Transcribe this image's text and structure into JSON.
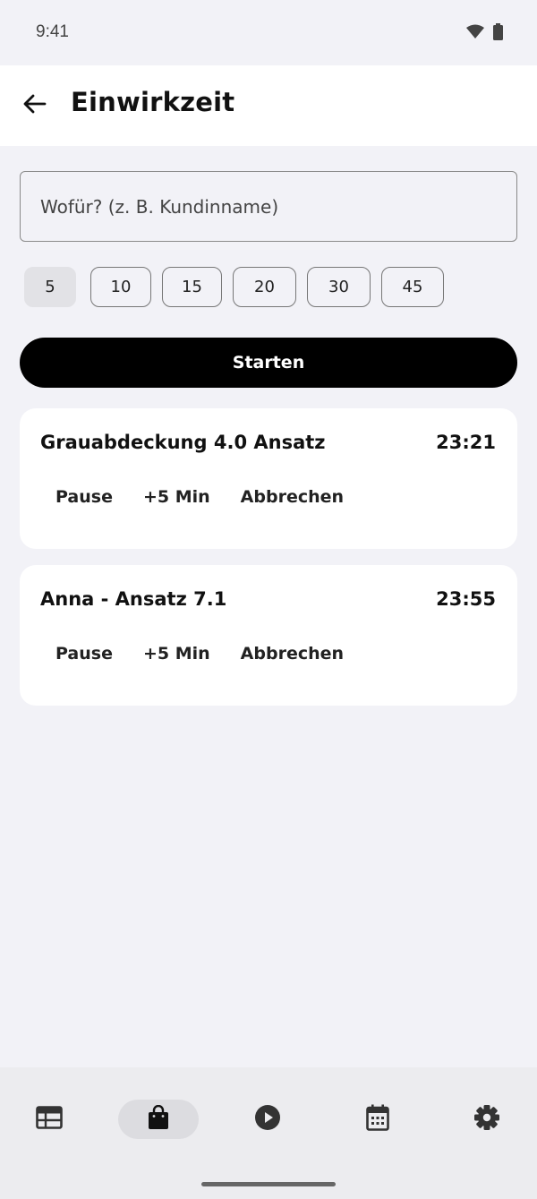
{
  "status_bar": {
    "time": "9:41",
    "icons": [
      "wifi-icon",
      "battery-icon"
    ]
  },
  "app_bar": {
    "back_icon": "arrow-left-icon",
    "title": "Einwirkzeit"
  },
  "search": {
    "placeholder": "Wofür? (z. B. Kundinname)",
    "value": ""
  },
  "durations": {
    "options": [
      "5",
      "10",
      "15",
      "20",
      "30",
      "45"
    ],
    "selected": "5"
  },
  "start_button": {
    "label": "Starten"
  },
  "timers": [
    {
      "name": "Grauabdeckung 4.0 Ansatz",
      "time": "23:21",
      "actions": {
        "pause": "Pause",
        "add": "+5 Min",
        "cancel": "Abbrechen"
      }
    },
    {
      "name": "Anna - Ansatz 7.1",
      "time": "23:55",
      "actions": {
        "pause": "Pause",
        "add": "+5 Min",
        "cancel": "Abbrechen"
      }
    }
  ],
  "bottom_nav": {
    "items": [
      {
        "icon": "table-icon",
        "active": false
      },
      {
        "icon": "shopping-bag-icon",
        "active": true
      },
      {
        "icon": "play-circle-icon",
        "active": false
      },
      {
        "icon": "calendar-icon",
        "active": false
      },
      {
        "icon": "gear-icon",
        "active": false
      }
    ]
  },
  "colors": {
    "background": "#f2f2f7",
    "surface": "#ffffff",
    "primary": "#000000",
    "nav_background": "#ececef",
    "chip_selected": "#e2e2e6"
  }
}
